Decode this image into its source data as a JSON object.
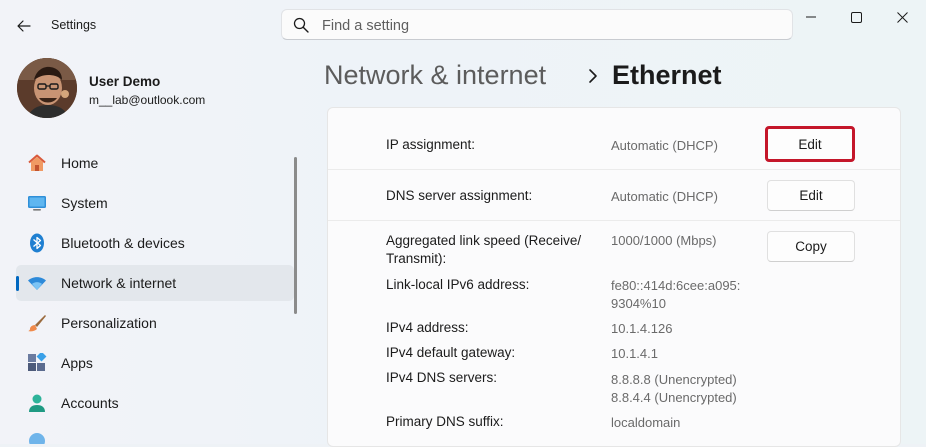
{
  "window": {
    "app_title": "Settings",
    "minimize_icon": "minimize-icon",
    "maximize_icon": "maximize-icon",
    "close_icon": "close-icon"
  },
  "search": {
    "placeholder": "Find a setting"
  },
  "user": {
    "name": "User Demo",
    "email": "m__lab@outlook.com"
  },
  "sidebar": {
    "items": [
      {
        "label": "Home",
        "icon": "home-icon",
        "selected": false
      },
      {
        "label": "System",
        "icon": "system-icon",
        "selected": false
      },
      {
        "label": "Bluetooth & devices",
        "icon": "bluetooth-icon",
        "selected": false
      },
      {
        "label": "Network & internet",
        "icon": "wifi-icon",
        "selected": true
      },
      {
        "label": "Personalization",
        "icon": "brush-icon",
        "selected": false
      },
      {
        "label": "Apps",
        "icon": "apps-icon",
        "selected": false
      },
      {
        "label": "Accounts",
        "icon": "person-icon",
        "selected": false
      }
    ]
  },
  "breadcrumb": {
    "parent": "Network & internet",
    "current": "Ethernet"
  },
  "content": {
    "rows": [
      {
        "label": "IP assignment:",
        "value": "Automatic (DHCP)",
        "button": "Edit"
      },
      {
        "label": "DNS server assignment:",
        "value": "Automatic (DHCP)",
        "button": "Edit"
      }
    ],
    "properties": [
      {
        "label_lines": [
          "Aggregated link speed (Receive/",
          "Transmit):"
        ],
        "value_lines": [
          "1000/1000 (Mbps)"
        ]
      },
      {
        "label_lines": [
          "Link-local IPv6 address:"
        ],
        "value_lines": [
          "fe80::414d:6cee:a095:",
          "9304%10"
        ]
      },
      {
        "label_lines": [
          "IPv4 address:"
        ],
        "value_lines": [
          "10.1.4.126"
        ]
      },
      {
        "label_lines": [
          "IPv4 default gateway:"
        ],
        "value_lines": [
          "10.1.4.1"
        ]
      },
      {
        "label_lines": [
          "IPv4 DNS servers:"
        ],
        "value_lines": [
          "8.8.8.8 (Unencrypted)",
          "8.8.4.4 (Unencrypted)"
        ]
      },
      {
        "label_lines": [
          "Primary DNS suffix:"
        ],
        "value_lines": [
          "localdomain"
        ]
      }
    ],
    "copy_button": "Copy"
  },
  "colors": {
    "accent": "#0067c0",
    "highlight_border": "#c4162a"
  }
}
